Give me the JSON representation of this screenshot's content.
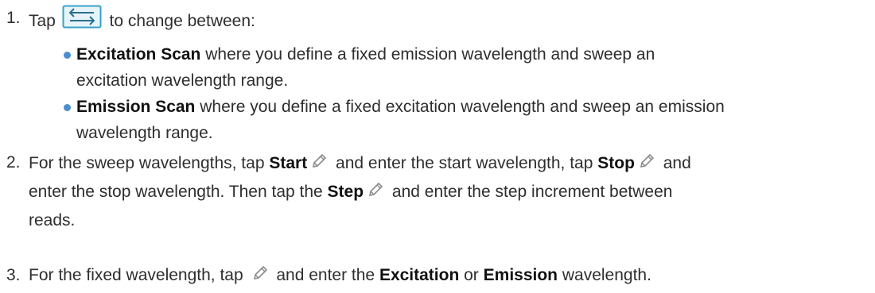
{
  "steps": [
    {
      "number": "1.",
      "pre": "Tap",
      "post": "to change between:",
      "icon": "swap-arrows-icon",
      "bullets": [
        {
          "bold": "Excitation Scan",
          "text_line1": " where you define a fixed emission wavelength and sweep an",
          "text_line2": "excitation wavelength range."
        },
        {
          "bold": "Emission Scan",
          "text_line1": " where you define a fixed excitation wavelength and sweep an emission",
          "text_line2": "wavelength range."
        }
      ]
    },
    {
      "number": "2.",
      "line1_a": "For the sweep wavelengths, tap ",
      "start": "Start",
      "line1_b": " and enter the start wavelength, tap ",
      "stop": "Stop",
      "line1_c": " and",
      "line2_a": "enter the stop wavelength. Then tap the ",
      "step": "Step",
      "line2_b": " and enter the step increment between",
      "line3": "reads.",
      "icon": "pencil-icon"
    },
    {
      "number": "3.",
      "a": "For the fixed wavelength, tap ",
      "b": " and enter the ",
      "excitation": "Excitation",
      "c": " or ",
      "emission": "Emission",
      "d": " wavelength."
    }
  ],
  "colors": {
    "text": "#2e2e2e",
    "bullet": "#4a8fcf",
    "icon_border": "#3aa0c8",
    "icon_bg": "#e6f4f9",
    "pencil": "#8a8a8a"
  }
}
